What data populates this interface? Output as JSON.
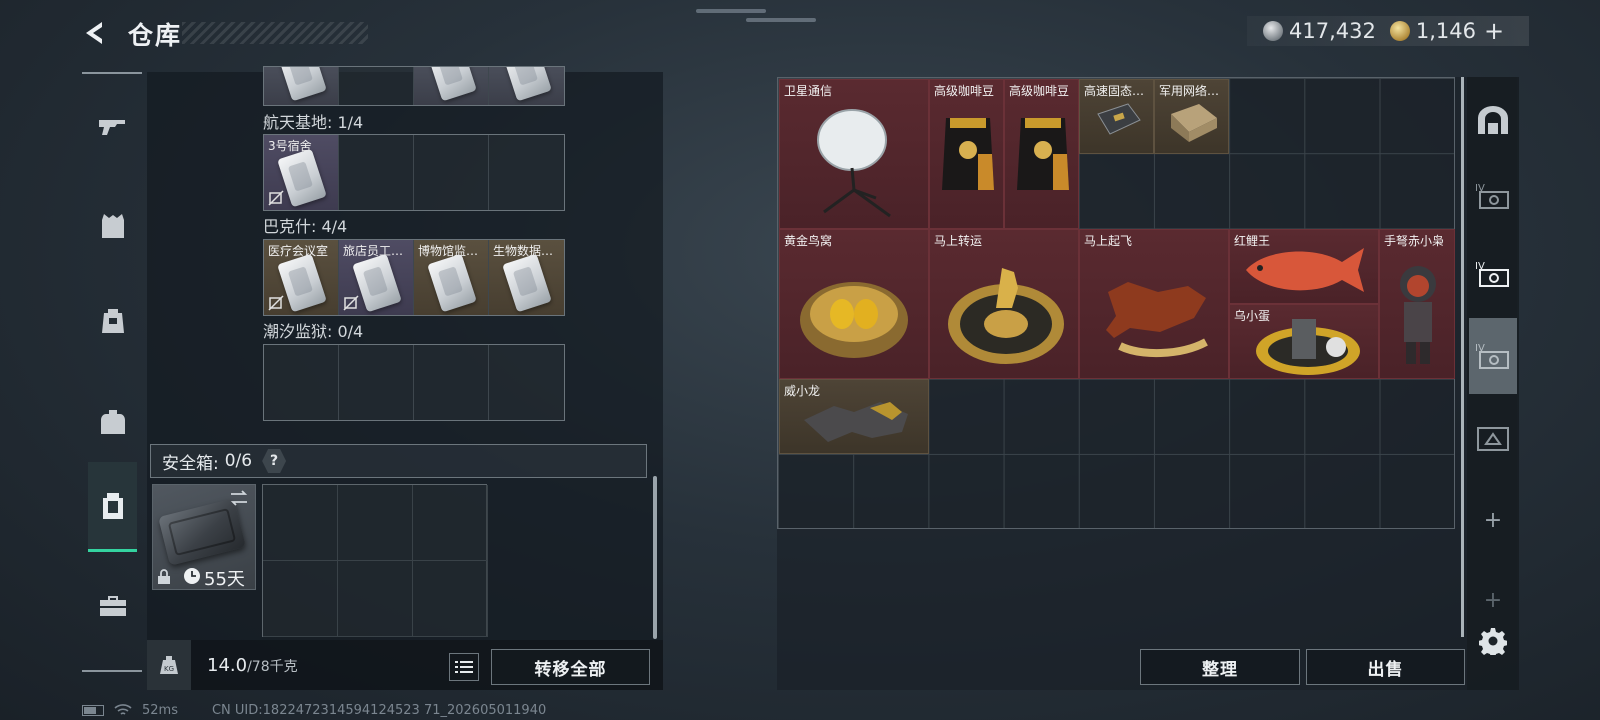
{
  "header": {
    "title": "仓库",
    "currency_silver": "417,432",
    "currency_gold": "1,146",
    "plus": "+"
  },
  "left_nav": {
    "items": [
      {
        "name": "weapon-tab",
        "icon": "rifle-icon"
      },
      {
        "name": "armor-tab",
        "icon": "vest-icon"
      },
      {
        "name": "helmet-tab",
        "icon": "backpack-icon"
      },
      {
        "name": "backpack-tab",
        "icon": "bag-icon"
      },
      {
        "name": "safebox-tab",
        "icon": "safebox-icon",
        "active": true
      },
      {
        "name": "toolbox-tab",
        "icon": "toolbox-icon"
      }
    ]
  },
  "keycards": {
    "sections": [
      {
        "label": "航天基地: 1/4",
        "slots": [
          "3号宿舍",
          "",
          "",
          ""
        ]
      },
      {
        "label": "巴克什: 4/4",
        "slots": [
          "医疗会议室",
          "旅店员工宿舍",
          "博物馆监控室",
          "生物数据中心"
        ]
      },
      {
        "label": "潮汐监狱: 0/4",
        "slots": [
          "",
          "",
          "",
          ""
        ]
      }
    ]
  },
  "safebox": {
    "label": "安全箱:",
    "count": "0/6",
    "help": "?",
    "duration": "55天"
  },
  "bottom": {
    "weight_current": "14.0",
    "weight_max": "/78千克",
    "transfer_all": "转移全部",
    "organize": "整理",
    "sell": "出售"
  },
  "status": {
    "ping": "52ms",
    "uid": "CN UID:1822472314594124523 71_202605011940"
  },
  "storage": {
    "items": [
      {
        "label": "卫星通信",
        "icon": "satellite-dish-icon",
        "rarity": "red"
      },
      {
        "label": "高级咖啡豆",
        "icon": "coffee-bag-icon",
        "rarity": "red"
      },
      {
        "label": "高级咖啡豆",
        "icon": "coffee-bag-icon",
        "rarity": "red"
      },
      {
        "label": "高速固态硬盘",
        "icon": "ssd-icon",
        "rarity": "gold"
      },
      {
        "label": "军用网络模块",
        "icon": "network-module-icon",
        "rarity": "gold"
      },
      {
        "label": "黄金鸟窝",
        "icon": "golden-nest-icon",
        "rarity": "red"
      },
      {
        "label": "马上转运",
        "icon": "horse-wheel-icon",
        "rarity": "red"
      },
      {
        "label": "马上起飞",
        "icon": "horse-statue-icon",
        "rarity": "red"
      },
      {
        "label": "红鲤王",
        "icon": "koi-fish-icon",
        "rarity": "red"
      },
      {
        "label": "手弩赤小枭",
        "icon": "figurine-icon",
        "rarity": "red"
      },
      {
        "label": "乌小蛋",
        "icon": "egg-figure-icon",
        "rarity": "red"
      },
      {
        "label": "威小龙",
        "icon": "dragon-gauntlet-icon",
        "rarity": "gold"
      }
    ]
  },
  "right_rail": {
    "items": [
      "tier-icon",
      "level-iv-box-icon",
      "level-iv-box-icon",
      "level-iv-box-icon",
      "level-iii-box-icon"
    ],
    "plus": "+"
  }
}
